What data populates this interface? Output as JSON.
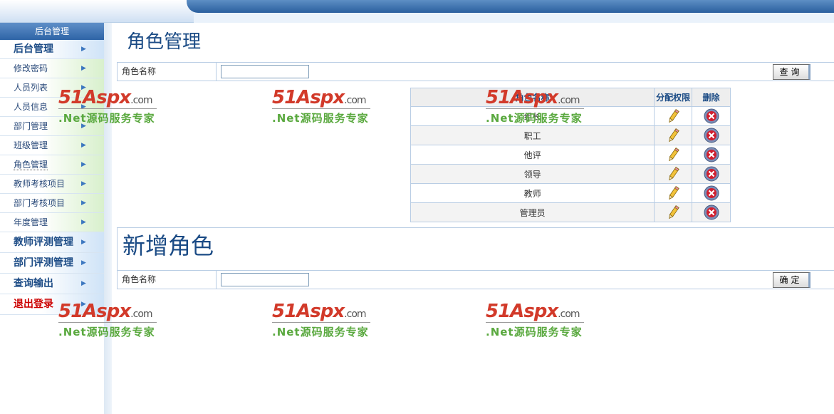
{
  "sidebar": {
    "title": "后台管理",
    "items": [
      {
        "label": "后台管理",
        "big": true
      },
      {
        "label": "修改密码"
      },
      {
        "label": "人员列表"
      },
      {
        "label": "人员信息"
      },
      {
        "label": "部门管理"
      },
      {
        "label": "班级管理"
      },
      {
        "label": "角色管理",
        "active": true
      },
      {
        "label": "教师考核项目"
      },
      {
        "label": "部门考核项目"
      },
      {
        "label": "年度管理"
      },
      {
        "label": "教师评测管理",
        "big": true
      },
      {
        "label": "部门评测管理",
        "big": true
      },
      {
        "label": "查询输出",
        "big": true
      },
      {
        "label": "退出登录",
        "big": true,
        "logout": true
      }
    ]
  },
  "main": {
    "title": "角色管理",
    "search": {
      "label": "角色名称",
      "value": "",
      "button": "查询"
    },
    "table": {
      "headers": {
        "name": "角色名称",
        "assign": "分配权限",
        "delete": "删除"
      },
      "rows": [
        "组长",
        "职工",
        "他评",
        "领导",
        "教师",
        "管理员"
      ]
    },
    "add": {
      "title": "新增角色",
      "label": "角色名称",
      "value": "",
      "button": "确定"
    }
  },
  "watermark": {
    "logo_text": "51Aspx",
    "logo_suffix": ".com",
    "slogan": ".Net源码服务专家"
  },
  "colors": {
    "accent": "#1b4b85",
    "menu_text": "#2a4a7a",
    "logout": "#cc0000",
    "delete_red": "#c8102e"
  }
}
